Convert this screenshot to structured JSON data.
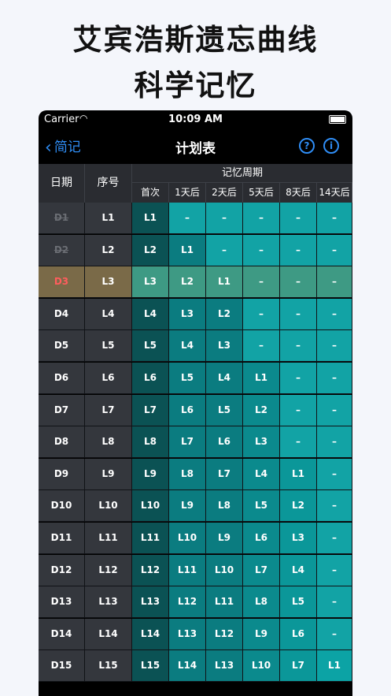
{
  "headline": {
    "line1": "艾宾浩斯遗忘曲线",
    "line2": "科学记忆"
  },
  "status_bar": {
    "carrier": "Carrier",
    "time": "10:09 AM"
  },
  "nav": {
    "back_label": "简记",
    "title": "计划表",
    "help_icon_char": "?",
    "info_icon_char": "i"
  },
  "table": {
    "col_date": "日期",
    "col_seq": "序号",
    "group_header": "记忆周期",
    "period_headers": [
      "首次",
      "1天后",
      "2天后",
      "5天后",
      "8天后",
      "14天后"
    ],
    "rows": [
      {
        "date": "D1",
        "seq": "L1",
        "cells": [
          "L1",
          "–",
          "–",
          "–",
          "–",
          "–"
        ],
        "done": true
      },
      {
        "date": "D2",
        "seq": "L2",
        "cells": [
          "L2",
          "L1",
          "–",
          "–",
          "–",
          "–"
        ],
        "done": true
      },
      {
        "date": "D3",
        "seq": "L3",
        "cells": [
          "L3",
          "L2",
          "L1",
          "–",
          "–",
          "–"
        ],
        "today": true
      },
      {
        "date": "D4",
        "seq": "L4",
        "cells": [
          "L4",
          "L3",
          "L2",
          "–",
          "–",
          "–"
        ]
      },
      {
        "date": "D5",
        "seq": "L5",
        "cells": [
          "L5",
          "L4",
          "L3",
          "–",
          "–",
          "–"
        ]
      },
      {
        "date": "D6",
        "seq": "L6",
        "cells": [
          "L6",
          "L5",
          "L4",
          "L1",
          "–",
          "–"
        ]
      },
      {
        "date": "D7",
        "seq": "L7",
        "cells": [
          "L7",
          "L6",
          "L5",
          "L2",
          "–",
          "–"
        ]
      },
      {
        "date": "D8",
        "seq": "L8",
        "cells": [
          "L8",
          "L7",
          "L6",
          "L3",
          "–",
          "–"
        ]
      },
      {
        "date": "D9",
        "seq": "L9",
        "cells": [
          "L9",
          "L8",
          "L7",
          "L4",
          "L1",
          "–"
        ]
      },
      {
        "date": "D10",
        "seq": "L10",
        "cells": [
          "L10",
          "L9",
          "L8",
          "L5",
          "L2",
          "–"
        ]
      },
      {
        "date": "D11",
        "seq": "L11",
        "cells": [
          "L11",
          "L10",
          "L9",
          "L6",
          "L3",
          "–"
        ]
      },
      {
        "date": "D12",
        "seq": "L12",
        "cells": [
          "L12",
          "L11",
          "L10",
          "L7",
          "L4",
          "–"
        ]
      },
      {
        "date": "D13",
        "seq": "L13",
        "cells": [
          "L13",
          "L12",
          "L11",
          "L8",
          "L5",
          "–"
        ]
      },
      {
        "date": "D14",
        "seq": "L14",
        "cells": [
          "L14",
          "L13",
          "L12",
          "L9",
          "L6",
          "–"
        ]
      },
      {
        "date": "D15",
        "seq": "L15",
        "cells": [
          "L15",
          "L14",
          "L13",
          "L10",
          "L7",
          "L1"
        ]
      }
    ]
  },
  "colors": {
    "accent": "#2f8df5",
    "period_columns": [
      "#0b5254",
      "#0b7c80",
      "#0b7c80",
      "#0b8a8d",
      "#0b9799",
      "#0ca3a5"
    ],
    "period_columns_empty": "#12a3a5",
    "today_row": "#7a6a48",
    "today_row_cells": "#3e9a84",
    "today_date_text": "#ff5d5d"
  }
}
